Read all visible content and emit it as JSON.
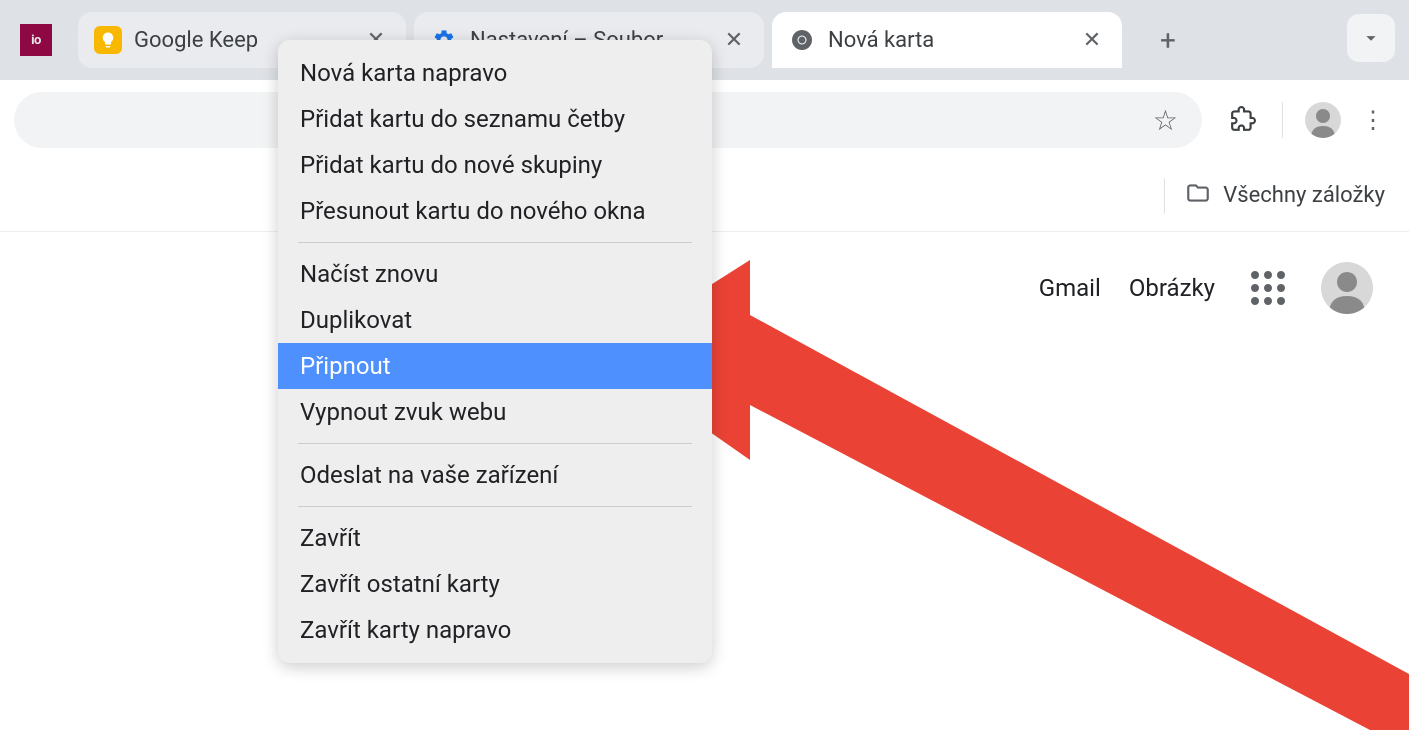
{
  "tabs": {
    "pinned": {
      "io_label": "io"
    },
    "keep": {
      "title": "Google Keep"
    },
    "settings": {
      "title": "Nastavení – Soubor"
    },
    "newtab": {
      "title": "Nová karta"
    }
  },
  "bookmarks": {
    "all_label": "Všechny záložky"
  },
  "header": {
    "gmail": "Gmail",
    "images": "Obrázky"
  },
  "context_menu": {
    "items": [
      {
        "label": "Nová karta napravo",
        "highlighted": false
      },
      {
        "label": "Přidat kartu do seznamu četby",
        "highlighted": false
      },
      {
        "label": "Přidat kartu do nové skupiny",
        "highlighted": false
      },
      {
        "label": "Přesunout kartu do nového okna",
        "highlighted": false
      }
    ],
    "group2": [
      {
        "label": "Načíst znovu",
        "highlighted": false
      },
      {
        "label": "Duplikovat",
        "highlighted": false
      },
      {
        "label": "Připnout",
        "highlighted": true
      },
      {
        "label": "Vypnout zvuk webu",
        "highlighted": false
      }
    ],
    "group3": [
      {
        "label": "Odeslat na vaše zařízení",
        "highlighted": false
      }
    ],
    "group4": [
      {
        "label": "Zavřít",
        "highlighted": false
      },
      {
        "label": "Zavřít ostatní karty",
        "highlighted": false
      },
      {
        "label": "Zavřít karty napravo",
        "highlighted": false
      }
    ]
  },
  "colors": {
    "highlight": "#4d90fe",
    "arrow": "#ea4335",
    "tab_strip": "#dee1e6"
  }
}
